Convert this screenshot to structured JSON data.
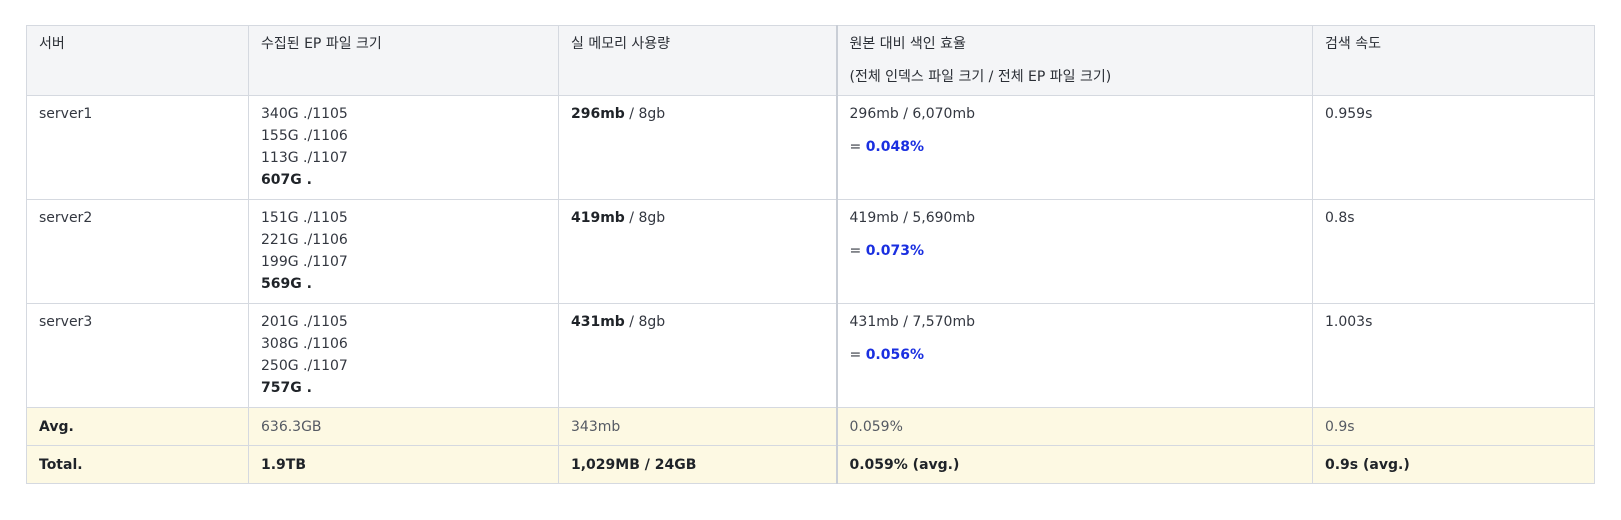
{
  "headers": {
    "server": "서버",
    "ep_size": "수집된 EP 파일 크기",
    "mem": "실 메모리 사용량",
    "efficiency": "원본 대비 색인 효율",
    "efficiency_sub": "(전체 인덱스 파일 크기 / 전체 EP 파일 크기)",
    "speed": "검색 속도"
  },
  "rows": [
    {
      "server": "server1",
      "files": [
        "340G ./1105",
        "155G ./1106",
        "113G ./1107"
      ],
      "files_total": "607G .",
      "mem_used": "296mb",
      "mem_total": " / 8gb",
      "ratio": "296mb / 6,070mb",
      "eq": "= ",
      "pct": "0.048%",
      "speed": "0.959s"
    },
    {
      "server": "server2",
      "files": [
        "151G ./1105",
        "221G ./1106",
        "199G ./1107"
      ],
      "files_total": "569G .",
      "mem_used": "419mb",
      "mem_total": " / 8gb",
      "ratio": "419mb / 5,690mb",
      "eq": "= ",
      "pct": "0.073%",
      "speed": "0.8s"
    },
    {
      "server": "server3",
      "files": [
        "201G ./1105",
        "308G ./1106",
        "250G ./1107"
      ],
      "files_total": "757G .",
      "mem_used": "431mb",
      "mem_total": " / 8gb",
      "ratio": "431mb / 7,570mb",
      "eq": "= ",
      "pct": "0.056%",
      "speed": "1.003s"
    }
  ],
  "avg": {
    "label": "Avg.",
    "ep_size": "636.3GB",
    "mem": "343mb",
    "efficiency": "0.059%",
    "speed": "0.9s"
  },
  "total": {
    "label": "Total.",
    "ep_size": "1.9TB",
    "mem": "1,029MB / 24GB",
    "efficiency": "0.059% (avg.)",
    "speed": "0.9s (avg.)"
  },
  "colors": {
    "highlight": "#1a2fe0",
    "summary_bg": "#fdf9e3",
    "header_bg": "#f4f5f7"
  }
}
